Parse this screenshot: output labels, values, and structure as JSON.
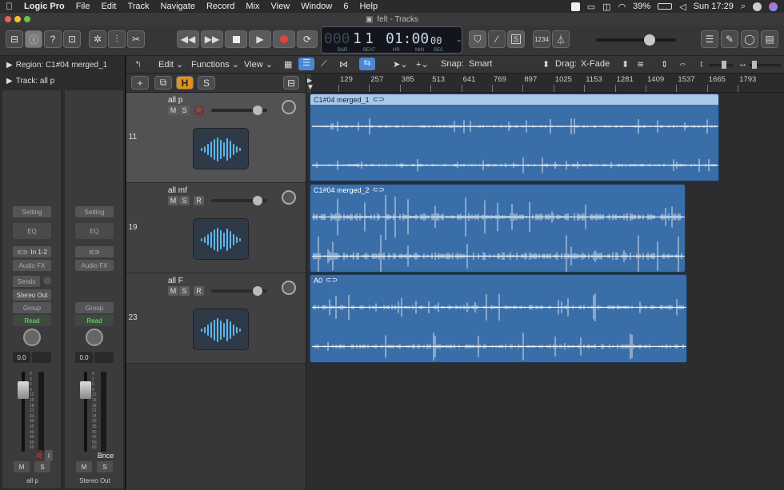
{
  "menubar": {
    "apple": "",
    "app": "Logic Pro",
    "items": [
      "File",
      "Edit",
      "Track",
      "Navigate",
      "Record",
      "Mix",
      "View",
      "Window",
      "6",
      "Help"
    ],
    "battery": "39%",
    "clock": "Sun 17:29"
  },
  "window": {
    "title": "felt - Tracks"
  },
  "lcd": {
    "bar": "1",
    "beat": "1",
    "hr_time": "01:00",
    "sec_time": "00",
    "labels": [
      "BAR",
      "BEAT",
      "HR",
      "MIN",
      "SEC"
    ],
    "dim_digits": "000"
  },
  "controlbar": {
    "count_in": "1234"
  },
  "inspector": {
    "region_label": "Region: C1#04 merged_1",
    "track_label": "Track:  all p",
    "strips": [
      {
        "setting": "Setting",
        "eq": "EQ",
        "input": "In 1-2",
        "fx": "Audio FX",
        "sends": "Sends",
        "output": "Stereo Out",
        "group": "Group",
        "automation": "Read",
        "pan_value": "0.0",
        "mute": "M",
        "solo": "S",
        "name": "all p",
        "r": "R",
        "i": "I"
      },
      {
        "setting": "Setting",
        "eq": "EQ",
        "input": "",
        "fx": "Audio FX",
        "sends": "",
        "output": "",
        "group": "Group",
        "automation": "Read",
        "pan_value": "0.0",
        "mute": "M",
        "solo": "S",
        "name": "Stereo Out",
        "bnce": "Bnce"
      }
    ],
    "scale": [
      "0",
      "3",
      "6",
      "9",
      "12",
      "15",
      "18",
      "21",
      "24",
      "30",
      "35",
      "40",
      "45",
      "50",
      "60"
    ]
  },
  "tracks_toolbar": {
    "edit": "Edit",
    "functions": "Functions",
    "view": "View",
    "snap_label": "Snap:",
    "snap_value": "Smart",
    "drag_label": "Drag:",
    "drag_value": "X-Fade"
  },
  "header_buttons": {
    "add": "+",
    "h": "H",
    "s": "S"
  },
  "ruler": {
    "marks": [
      "129",
      "257",
      "385",
      "513",
      "641",
      "769",
      "897",
      "1025",
      "1153",
      "1281",
      "1409",
      "1537",
      "1665",
      "1793"
    ]
  },
  "tracks": [
    {
      "number": "11",
      "name": "all p",
      "mute": "M",
      "solo": "S",
      "rec": "R",
      "volume_fraction": 0.85
    },
    {
      "number": "19",
      "name": "all mf",
      "mute": "M",
      "solo": "S",
      "rec": "R",
      "volume_fraction": 0.85
    },
    {
      "number": "23",
      "name": "all F",
      "mute": "M",
      "solo": "S",
      "rec": "R",
      "volume_fraction": 0.85
    }
  ],
  "regions": [
    {
      "name": "C1#04 merged_1",
      "selected": true
    },
    {
      "name": "C1#04 merged_2",
      "selected": false
    },
    {
      "name": "A0",
      "selected": false
    }
  ],
  "colors": {
    "region_blue": "#3a6ea8",
    "record_red": "#e0453e",
    "h_orange": "#e0901e",
    "read_green": "#7de07d"
  }
}
